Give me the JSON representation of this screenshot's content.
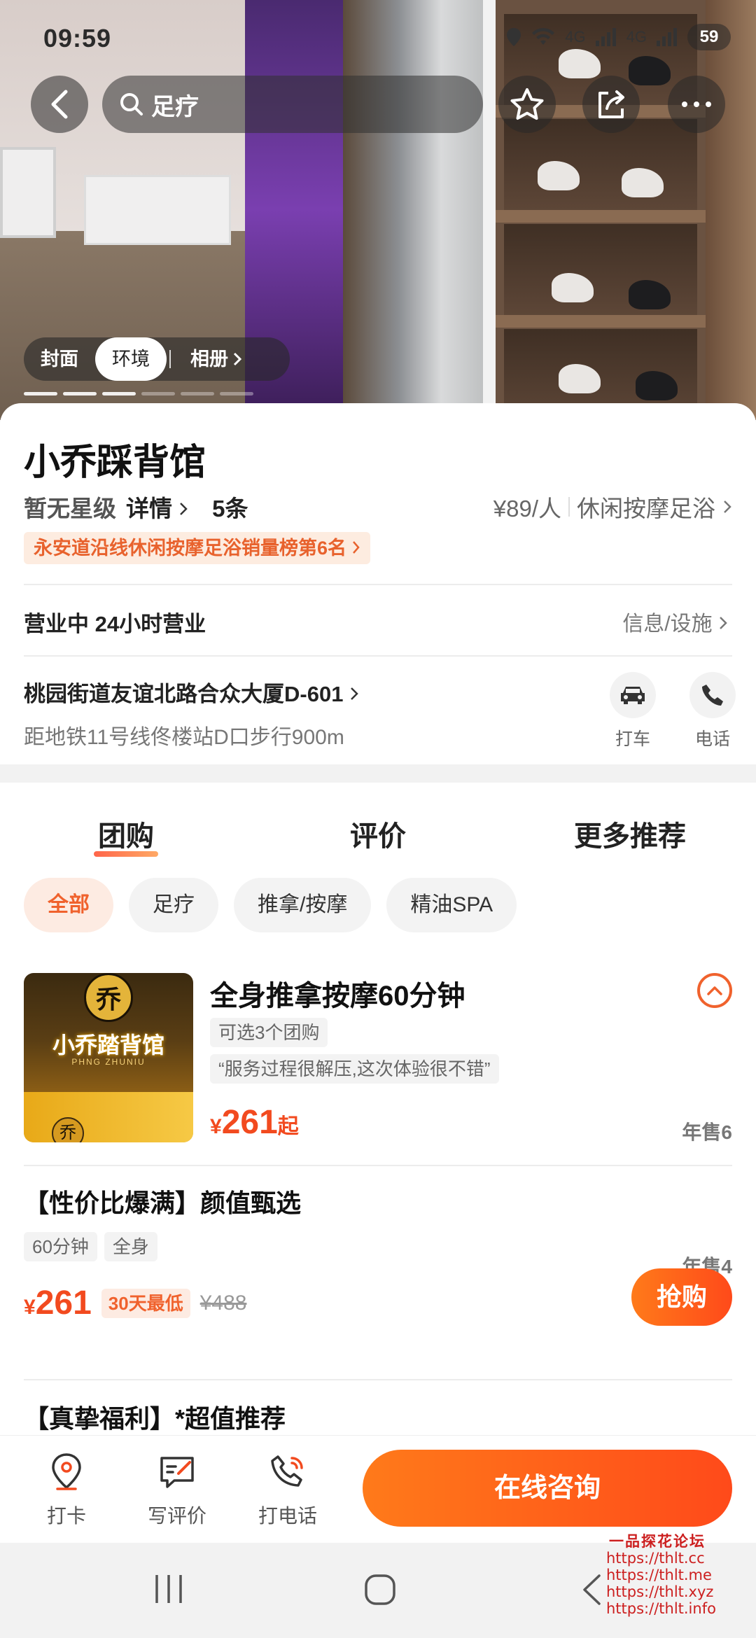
{
  "status_bar": {
    "time": "09:59",
    "network": "4G",
    "battery": "59"
  },
  "nav": {
    "search_text": "足疗"
  },
  "photo_tabs": [
    {
      "label": "封面",
      "active": false
    },
    {
      "label": "环境",
      "active": true
    },
    {
      "label": "相册",
      "active": false
    }
  ],
  "shop": {
    "name": "小乔踩背馆",
    "star_level": "暂无星级",
    "detail_label": "详情",
    "review_count": "5条",
    "price_per_person": "¥89/人",
    "category": "休闲按摩足浴",
    "rank_text": "永安道沿线休闲按摩足浴销量榜第6名",
    "status": "营业中 24小时营业",
    "info_link": "信息/设施",
    "address": "桃园街道友谊北路合众大厦D-601",
    "metro": "距地铁11号线佟楼站D口步行900m",
    "actions": [
      {
        "label": "打车",
        "icon": "car-icon"
      },
      {
        "label": "电话",
        "icon": "phone-icon"
      }
    ]
  },
  "tabs": [
    {
      "label": "团购",
      "active": true
    },
    {
      "label": "评价",
      "active": false
    },
    {
      "label": "更多推荐",
      "active": false
    }
  ],
  "chips": [
    {
      "label": "全部",
      "active": true
    },
    {
      "label": "足疗",
      "active": false
    },
    {
      "label": "推拿/按摩",
      "active": false
    },
    {
      "label": "精油SPA",
      "active": false
    }
  ],
  "deal1": {
    "title": "全身推拿按摩60分钟",
    "options": "可选3个团购",
    "quote": "“服务过程很解压,这次体验很不错”",
    "currency": "¥",
    "price": "261",
    "price_suffix": "起",
    "sold": "年售6",
    "thumb_logo": "乔",
    "thumb_name": "小乔踏背馆",
    "thumb_sub": "PHNG ZHUNIU"
  },
  "deal2": {
    "title": "【性价比爆满】颜值甄选",
    "tags": [
      "60分钟",
      "全身"
    ],
    "sold": "年售4",
    "currency": "¥",
    "price": "261",
    "lowest_badge": "30天最低",
    "original_price": "¥488",
    "buy_label": "抢购"
  },
  "deal3": {
    "title": "【真挚福利】*超值推荐"
  },
  "bottom_bar": {
    "checkin": "打卡",
    "review": "写评价",
    "call": "打电话",
    "consult": "在线咨询"
  },
  "watermark": {
    "title": "一品探花论坛",
    "lines": [
      "https://thlt.cc",
      "https://thlt.me",
      "https://thlt.xyz",
      "https://thlt.info"
    ]
  },
  "colors": {
    "accent": "#f24a1f",
    "accent_light": "#fdebe2",
    "cta_gradient": [
      "#ff7a1a",
      "#ff4a1a"
    ]
  }
}
